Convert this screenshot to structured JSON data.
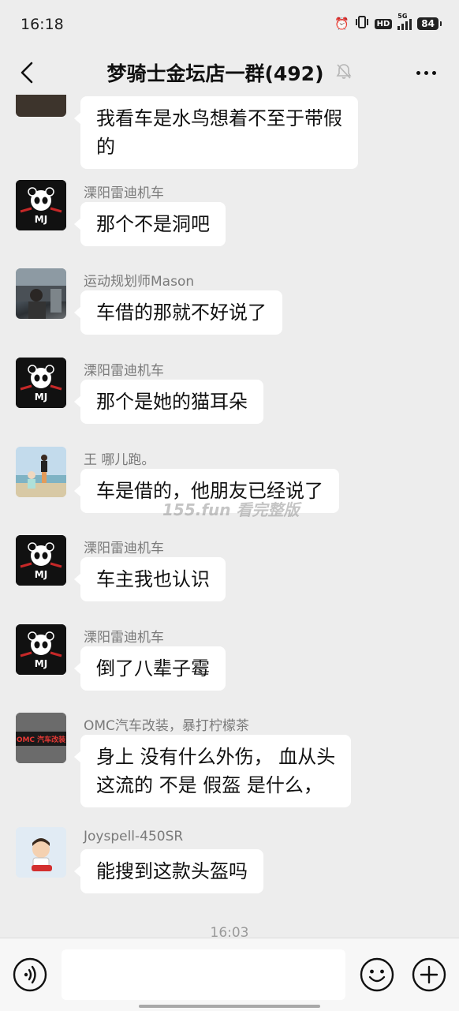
{
  "status": {
    "time": "16:18",
    "network": "5G",
    "hd": "HD",
    "battery": "84"
  },
  "header": {
    "title": "梦骑士金坛店一群(492)"
  },
  "watermark": "155.fun 看完整版",
  "messages": [
    {
      "sender": "",
      "lines": [
        "我看车是水鸟想着不至于带假",
        "的"
      ]
    },
    {
      "sender": "溧阳雷迪机车",
      "lines": [
        "那个不是洞吧"
      ]
    },
    {
      "sender": "运动规划师Mason",
      "lines": [
        "车借的那就不好说了"
      ]
    },
    {
      "sender": "溧阳雷迪机车",
      "lines": [
        "那个是她的猫耳朵"
      ]
    },
    {
      "sender": "王 哪儿跑。",
      "lines": [
        "车是借的，他朋友已经说了"
      ]
    },
    {
      "sender": "溧阳雷迪机车",
      "lines": [
        "车主我也认识"
      ]
    },
    {
      "sender": "溧阳雷迪机车",
      "lines": [
        "倒了八辈子霉"
      ]
    },
    {
      "sender": "OMC汽车改装，暴打柠檬茶",
      "lines": [
        "身上 没有什么外伤，  血从头",
        "这流的  不是 假盔 是什么，"
      ]
    },
    {
      "sender": "Joyspell-450SR",
      "lines": [
        "能搜到这款头盔吗"
      ]
    }
  ],
  "time_separator": "16:03",
  "avatar_labels": {
    "panda": "MJ",
    "omc": "OMC 汽车改装"
  },
  "input": {
    "value": "",
    "placeholder": ""
  }
}
